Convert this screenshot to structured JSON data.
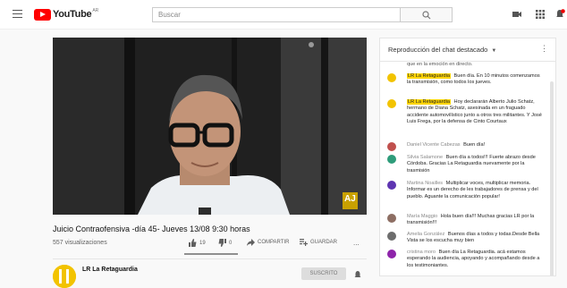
{
  "header": {
    "logo_text": "YouTube",
    "logo_country": "AR",
    "search_placeholder": "Buscar"
  },
  "video": {
    "title": "Juicio Contraofensiva -día 45- Jueves 13/08 9:30 horas",
    "views": "557 visualizaciones",
    "likes": "19",
    "dislikes": "0",
    "like_ratio": 1.0,
    "share_label": "COMPARTIR",
    "save_label": "GUARDAR",
    "more_label": "...",
    "watermark": "AJ"
  },
  "channel": {
    "name": "LR La Retaguardia",
    "subscribe_label": "SUSCRITO"
  },
  "chat": {
    "header_title": "Reproducción del chat destacado",
    "messages": [
      {
        "author": "",
        "text": "que en la emoción en directo.",
        "owner": false,
        "avatar_color": "#ffffff"
      },
      {
        "author": "LR La Retaguardia",
        "text": "Buen día. En 10 minutos comenzamos la transmisión, como todos los jueves.",
        "owner": true,
        "avatar_color": "#f2c300"
      },
      {
        "author": "LR La Retaguardia",
        "text": "Hoy declararán Alberto Julio Schatz, hermano de Diana Schatz, asesinada en un fraguado accidente automovilístico junto a otros tres militantes. Y José Luis Frega, por la defensa de Cinto Courtaux",
        "owner": true,
        "avatar_color": "#f2c300"
      },
      {
        "author": "Daniel Vicente Cabezas",
        "text": "Buen día!",
        "owner": false,
        "avatar_color": "#c0504d"
      },
      {
        "author": "Silvia Salamone",
        "text": "Buen día a todos!!! Fuerte abrazo desde Córdoba. Gracias La Retaguardia nuevamente por la trasmisión",
        "owner": false,
        "avatar_color": "#2e9c7a"
      },
      {
        "author": "Martina Noailles",
        "text": "Multiplicar voces, multiplicar memoria. Informar es un derecho de les trabajadores de prensa y del pueblo. Aguante la comunicación popular!",
        "owner": false,
        "avatar_color": "#5e35b1"
      },
      {
        "author": "María Maggio",
        "text": "Hola buen día!!! Muchas gracias LR por la transmisión!!!",
        "owner": false,
        "avatar_color": "#8d6e63"
      },
      {
        "author": "Amelia González",
        "text": "Buenos días a todos y todas.Desde Bella Vista se los escucha muy bien",
        "owner": false,
        "avatar_color": "#6d6d6d"
      },
      {
        "author": "cristina moro",
        "text": "Buen día La Retaguardia. acá estamos esperando la audiencia, apoyando y acompañando desde a los testimoniantes.",
        "owner": false,
        "avatar_color": "#8e24aa"
      }
    ]
  },
  "colors": {
    "brand": "#ff0000",
    "owner_badge": "#ffd600",
    "channel_avatar": "#f2c300"
  }
}
